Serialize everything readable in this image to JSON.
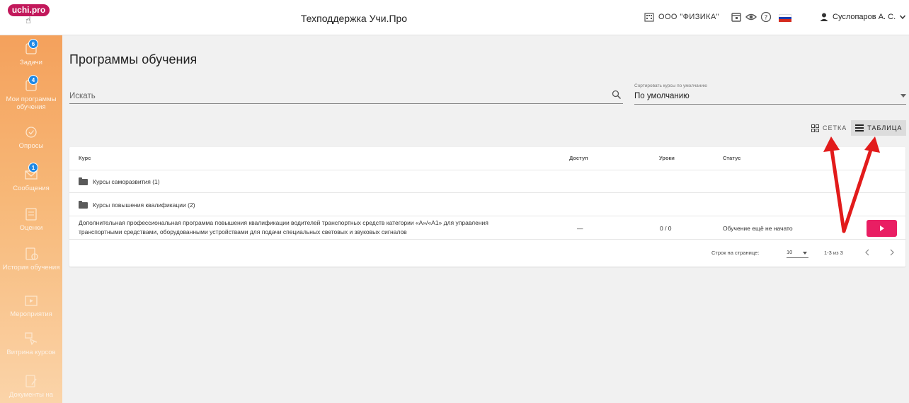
{
  "header": {
    "logo": "uchi.pro",
    "title": "Техподдержка Учи.Про",
    "org": "ООО \"ФИЗИКА\"",
    "user": "Суслопаров А. С."
  },
  "sidebar": {
    "items": [
      {
        "label": "Задачи",
        "badge": "6"
      },
      {
        "label": "Мои программы обучения",
        "badge": "4"
      },
      {
        "label": "Опросы",
        "badge": ""
      },
      {
        "label": "Сообщения",
        "badge": "1"
      },
      {
        "label": "Оценки",
        "badge": ""
      },
      {
        "label": "История обучения",
        "badge": ""
      },
      {
        "label": "Мероприятия",
        "badge": ""
      },
      {
        "label": "Витрина курсов",
        "badge": ""
      },
      {
        "label": "Документы на",
        "badge": ""
      }
    ]
  },
  "main": {
    "title": "Программы обучения",
    "search_placeholder": "Искать",
    "sort_label": "Сортировать курсы по умолчанию",
    "sort_value": "По умолчанию",
    "view_grid": "СЕТКА",
    "view_table": "ТАБЛИЦА"
  },
  "table": {
    "headers": {
      "course": "Курс",
      "access": "Доступ",
      "lessons": "Уроки",
      "status": "Статус"
    },
    "folders": [
      "Курсы саморазвития (1)",
      "Курсы повышения квалификации (2)"
    ],
    "row": {
      "course_line1": "Дополнительная профессиональная программа повышения квалификации водителей транспортных средств категории «А»/«А1» для управления",
      "course_line2": "транспортными средствами, оборудованными устройствами для подачи специальных световых и звуковых сигналов",
      "access": "—",
      "lessons": "0 / 0",
      "status": "Обучение ещё не начато"
    },
    "pagination": {
      "rows_per_page_label": "Строк на странице:",
      "rows_per_page": "10",
      "range": "1-3 из 3"
    }
  },
  "colors": {
    "accent": "#e91e63",
    "sidebar": "#f4a15c",
    "badge": "#1e88e5",
    "arrow": "#e21b1b"
  }
}
